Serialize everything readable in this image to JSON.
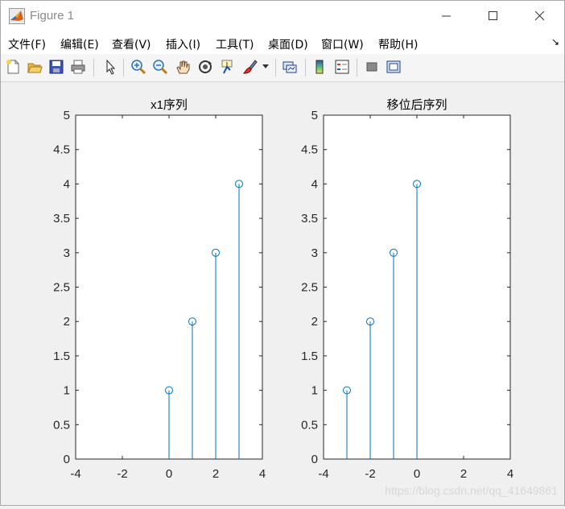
{
  "window": {
    "title": "Figure 1",
    "icon": "matlab-icon",
    "controls": [
      "minimize-icon",
      "maximize-icon",
      "close-icon"
    ]
  },
  "menu": {
    "items": [
      "文件(F)",
      "编辑(E)",
      "查看(V)",
      "插入(I)",
      "工具(T)",
      "桌面(D)",
      "窗口(W)",
      "帮助(H)"
    ],
    "dock_icon": "↘"
  },
  "toolbar": {
    "icons": [
      "new-figure-icon",
      "open-file-icon",
      "save-icon",
      "print-icon",
      "select-arrow-icon",
      "zoom-in-icon",
      "zoom-out-icon",
      "pan-hand-icon",
      "rotate-3d-icon",
      "data-cursor-icon",
      "brush-icon",
      "brush-dropdown-icon",
      "link-plot-icon",
      "colorbar-icon",
      "legend-icon",
      "hide-plot-tools-icon",
      "show-plot-tools-icon"
    ]
  },
  "chart_data": [
    {
      "type": "stem",
      "title": "x1序列",
      "x": [
        0,
        1,
        2,
        3
      ],
      "y": [
        1,
        2,
        3,
        4
      ],
      "xlim": [
        -4,
        4
      ],
      "ylim": [
        0,
        5
      ],
      "xticks": [
        "-4",
        "-2",
        "0",
        "2",
        "4"
      ],
      "yticks": [
        "0",
        "0.5",
        "1",
        "1.5",
        "2",
        "2.5",
        "3",
        "3.5",
        "4",
        "4.5",
        "5"
      ],
      "color": "#0072bd",
      "grid": false
    },
    {
      "type": "stem",
      "title": "移位后序列",
      "x": [
        -3,
        -2,
        -1,
        0
      ],
      "y": [
        1,
        2,
        3,
        4
      ],
      "xlim": [
        -4,
        4
      ],
      "ylim": [
        0,
        5
      ],
      "xticks": [
        "-4",
        "-2",
        "0",
        "2",
        "4"
      ],
      "yticks": [
        "0",
        "0.5",
        "1",
        "1.5",
        "2",
        "2.5",
        "3",
        "3.5",
        "4",
        "4.5",
        "5"
      ],
      "color": "#0072bd",
      "grid": false
    }
  ],
  "watermark": "https://blog.csdn.net/qq_41649861"
}
